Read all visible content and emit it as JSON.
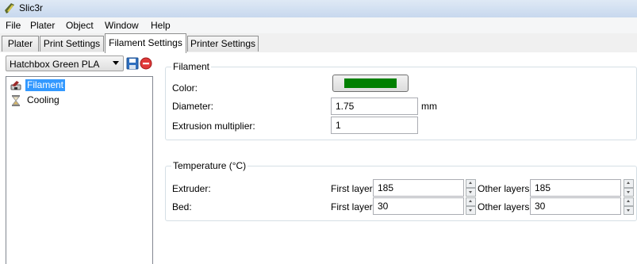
{
  "window": {
    "title": "Slic3r"
  },
  "menu": {
    "items": [
      "File",
      "Plater",
      "Object",
      "Window",
      "Help"
    ]
  },
  "tabs": [
    {
      "label": "Plater"
    },
    {
      "label": "Print Settings"
    },
    {
      "label": "Filament Settings",
      "active": true
    },
    {
      "label": "Printer Settings"
    }
  ],
  "preset": {
    "selected": "Hatchbox Green PLA"
  },
  "tree": {
    "items": [
      {
        "label": "Filament",
        "selected": true,
        "icon": "filament-spool-icon"
      },
      {
        "label": "Cooling",
        "selected": false,
        "icon": "hourglass-icon"
      }
    ]
  },
  "filament": {
    "title": "Filament",
    "color_label": "Color:",
    "color_value": "#008000",
    "diameter_label": "Diameter:",
    "diameter_value": "1.75",
    "diameter_unit": "mm",
    "extrusion_label": "Extrusion multiplier:",
    "extrusion_value": "1"
  },
  "temperature": {
    "title": "Temperature (°C)",
    "extruder_label": "Extruder:",
    "bed_label": "Bed:",
    "first_layer_label": "First layer:",
    "other_layers_label": "Other layers:",
    "extruder_first": "185",
    "extruder_other": "185",
    "bed_first": "30",
    "bed_other": "30"
  },
  "colors": {
    "selection": "#3399ff",
    "filament_swatch": "#008000"
  }
}
